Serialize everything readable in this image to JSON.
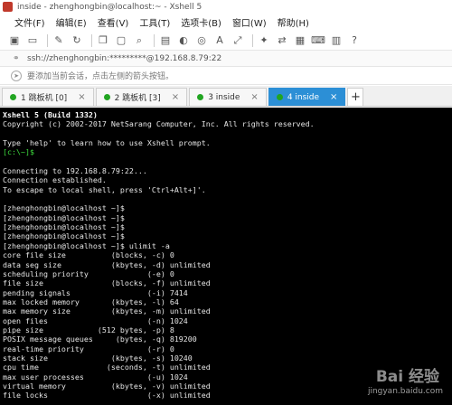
{
  "window": {
    "title": "inside - zhenghongbin@localhost:~ - Xshell 5"
  },
  "menu": [
    "文件(F)",
    "编辑(E)",
    "查看(V)",
    "工具(T)",
    "选项卡(B)",
    "窗口(W)",
    "帮助(H)"
  ],
  "toolbar_icons": [
    "new-session-icon",
    "open-folder-icon",
    "disconnect-icon",
    "reconnect-icon",
    "copy-icon",
    "paste-icon",
    "find-icon",
    "print-icon",
    "color-icon",
    "globe-icon",
    "font-icon",
    "fullscreen-icon",
    "xftp-icon",
    "lock-icon",
    "keyboard-icon",
    "help-icon"
  ],
  "address": {
    "text": "ssh://zhenghongbin:*********@192.168.8.79:22"
  },
  "tip": {
    "text": "要添加当前会话，点击左侧的箭头按钮。"
  },
  "tabs": [
    {
      "label": "1 跳板机 [0]",
      "active": false
    },
    {
      "label": "2 跳板机 [3]",
      "active": false
    },
    {
      "label": "3 inside",
      "active": false
    },
    {
      "label": "4 inside",
      "active": true
    }
  ],
  "tab_add_label": "+",
  "terminal": {
    "lines": [
      {
        "text": "Xshell 5 (Build 1332)",
        "style": "bold"
      },
      {
        "text": "Copyright (c) 2002-2017 NetSarang Computer, Inc. All rights reserved.",
        "style": ""
      },
      {
        "text": "",
        "style": ""
      },
      {
        "text": "Type 'help' to learn how to use Xshell prompt.",
        "style": ""
      },
      {
        "text": "[c:\\~]$",
        "style": "prompt"
      },
      {
        "text": "",
        "style": ""
      },
      {
        "text": "Connecting to 192.168.8.79:22...",
        "style": ""
      },
      {
        "text": "Connection established.",
        "style": ""
      },
      {
        "text": "To escape to local shell, press 'Ctrl+Alt+]'.",
        "style": ""
      },
      {
        "text": "",
        "style": ""
      },
      {
        "text": "[zhenghongbin@localhost ~]$",
        "style": ""
      },
      {
        "text": "[zhenghongbin@localhost ~]$",
        "style": ""
      },
      {
        "text": "[zhenghongbin@localhost ~]$",
        "style": ""
      },
      {
        "text": "[zhenghongbin@localhost ~]$",
        "style": ""
      },
      {
        "text": "[zhenghongbin@localhost ~]$ ulimit -a",
        "style": ""
      },
      {
        "text": "core file size          (blocks, -c) 0",
        "style": ""
      },
      {
        "text": "data seg size           (kbytes, -d) unlimited",
        "style": ""
      },
      {
        "text": "scheduling priority             (-e) 0",
        "style": ""
      },
      {
        "text": "file size               (blocks, -f) unlimited",
        "style": ""
      },
      {
        "text": "pending signals                 (-i) 7414",
        "style": ""
      },
      {
        "text": "max locked memory       (kbytes, -l) 64",
        "style": ""
      },
      {
        "text": "max memory size         (kbytes, -m) unlimited",
        "style": ""
      },
      {
        "text": "open files                      (-n) 1024",
        "style": ""
      },
      {
        "text": "pipe size            (512 bytes, -p) 8",
        "style": ""
      },
      {
        "text": "POSIX message queues     (bytes, -q) 819200",
        "style": ""
      },
      {
        "text": "real-time priority              (-r) 0",
        "style": ""
      },
      {
        "text": "stack size              (kbytes, -s) 10240",
        "style": ""
      },
      {
        "text": "cpu time               (seconds, -t) unlimited",
        "style": ""
      },
      {
        "text": "max user processes              (-u) 1024",
        "style": ""
      },
      {
        "text": "virtual memory          (kbytes, -v) unlimited",
        "style": ""
      },
      {
        "text": "file locks                      (-x) unlimited",
        "style": ""
      }
    ]
  },
  "watermark": {
    "logo": "Bai 经验",
    "url": "jingyan.baidu.com"
  },
  "colors": {
    "active_tab": "#2c8fd6",
    "tab_dot": "#21a521",
    "prompt": "#3ddc3d",
    "terminal_bg": "#000000"
  }
}
